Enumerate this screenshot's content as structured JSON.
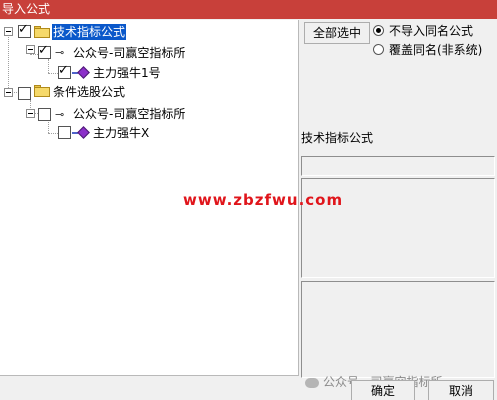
{
  "window": {
    "title": "导入公式"
  },
  "tree": {
    "nodes": [
      {
        "label": "技术指标公式",
        "checked": true,
        "selected": true,
        "icon": "folder-icon"
      },
      {
        "label": "公众号-司赢空指标所",
        "checked": true,
        "icon": "key-icon"
      },
      {
        "label": "主力强牛1号",
        "checked": true,
        "icon": "formula-gem-icon"
      },
      {
        "label": "条件选股公式",
        "checked": false,
        "icon": "folder-icon"
      },
      {
        "label": "公众号-司赢空指标所",
        "checked": false,
        "icon": "key-icon"
      },
      {
        "label": "主力强牛X",
        "checked": false,
        "icon": "formula-gem-icon"
      }
    ]
  },
  "options": {
    "select_all_label": "全部选中",
    "radio_no_import": "不导入同名公式",
    "radio_overwrite": "覆盖同名(非系统)",
    "selected_radio": "不导入同名公式"
  },
  "detail": {
    "title": "技术指标公式"
  },
  "footer": {
    "ok_label": "确定",
    "cancel_label": "取消",
    "credit": "公众号 · 司赢空指标所"
  },
  "overlay": {
    "watermark": "www.zbzfwu.com"
  },
  "colors": {
    "titlebar": "#c8403a",
    "selection": "#0a58ca",
    "watermark": "#e0151b"
  }
}
